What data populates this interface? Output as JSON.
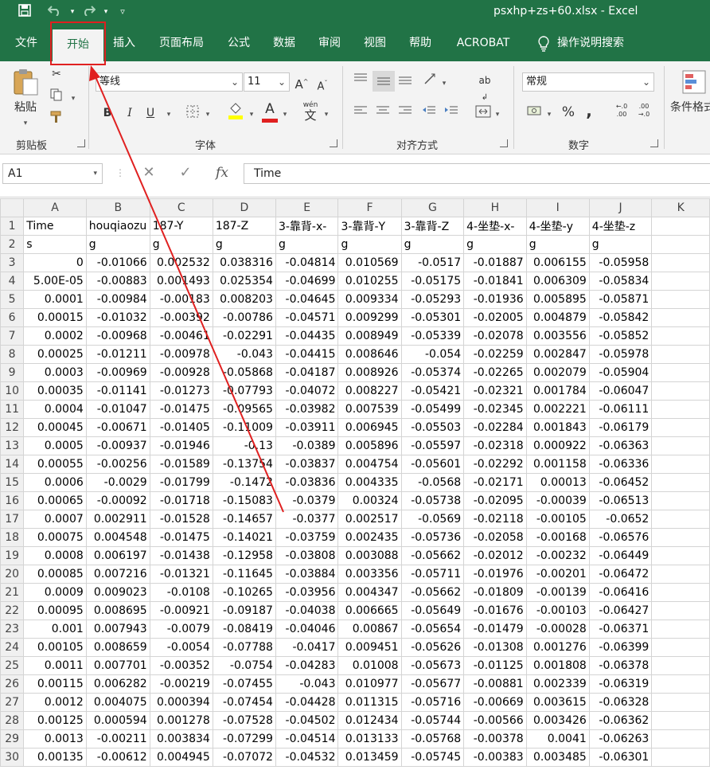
{
  "title_bar": {
    "title": "psxhp+zs+60.xlsx  -  Excel"
  },
  "tabs": [
    {
      "label": "文件",
      "active": false
    },
    {
      "label": "开始",
      "active": true
    },
    {
      "label": "插入",
      "active": false
    },
    {
      "label": "页面布局",
      "active": false
    },
    {
      "label": "公式",
      "active": false
    },
    {
      "label": "数据",
      "active": false
    },
    {
      "label": "审阅",
      "active": false
    },
    {
      "label": "视图",
      "active": false
    },
    {
      "label": "帮助",
      "active": false
    },
    {
      "label": "ACROBAT",
      "active": false
    }
  ],
  "tell_me": "操作说明搜索",
  "ribbon": {
    "clipboard": {
      "label": "剪贴板",
      "paste": "粘贴"
    },
    "font": {
      "label": "字体",
      "font_name": "等线",
      "font_size": "11",
      "bold": "B",
      "italic": "I",
      "underline": "U",
      "font_color": "A",
      "phonetic": "wén",
      "phonetic_sub": "文"
    },
    "alignment": {
      "label": "对齐方式"
    },
    "number": {
      "label": "数字",
      "format": "常规",
      "percent": "%",
      "comma": ","
    },
    "styles": {
      "conditional": "条件格式"
    }
  },
  "formula_bar": {
    "name_box": "A1",
    "formula": "Time"
  },
  "accent_colors": {
    "excel_green": "#217346",
    "highlight_red": "#e02020",
    "font_color_red": "#e02020",
    "fill_yellow": "#ffff00"
  },
  "sheet": {
    "columns": [
      "A",
      "B",
      "C",
      "D",
      "E",
      "F",
      "G",
      "H",
      "I",
      "J",
      "K"
    ],
    "header_row": [
      "Time",
      "houqiaozu",
      "187-Y",
      "187-Z",
      "3-靠背-x-",
      "3-靠背-Y",
      "3-靠背-Z",
      "4-坐垫-x-",
      "4-坐垫-y",
      "4-坐垫-z",
      ""
    ],
    "unit_row": [
      "s",
      "g",
      "g",
      "g",
      "g",
      "g",
      "g",
      "g",
      "g",
      "g",
      ""
    ],
    "data_rows": [
      [
        "0",
        "-0.01066",
        "0.002532",
        "0.038316",
        "-0.04814",
        "0.010569",
        "-0.0517",
        "-0.01887",
        "0.006155",
        "-0.05958"
      ],
      [
        "5.00E-05",
        "-0.00883",
        "0.001493",
        "0.025354",
        "-0.04699",
        "0.010255",
        "-0.05175",
        "-0.01841",
        "0.006309",
        "-0.05834"
      ],
      [
        "0.0001",
        "-0.00984",
        "-0.00183",
        "0.008203",
        "-0.04645",
        "0.009334",
        "-0.05293",
        "-0.01936",
        "0.005895",
        "-0.05871"
      ],
      [
        "0.00015",
        "-0.01032",
        "-0.00392",
        "-0.00786",
        "-0.04571",
        "0.009299",
        "-0.05301",
        "-0.02005",
        "0.004879",
        "-0.05842"
      ],
      [
        "0.0002",
        "-0.00968",
        "-0.00461",
        "-0.02291",
        "-0.04435",
        "0.008949",
        "-0.05339",
        "-0.02078",
        "0.003556",
        "-0.05852"
      ],
      [
        "0.00025",
        "-0.01211",
        "-0.00978",
        "-0.043",
        "-0.04415",
        "0.008646",
        "-0.054",
        "-0.02259",
        "0.002847",
        "-0.05978"
      ],
      [
        "0.0003",
        "-0.00969",
        "-0.00928",
        "-0.05868",
        "-0.04187",
        "0.008926",
        "-0.05374",
        "-0.02265",
        "0.002079",
        "-0.05904"
      ],
      [
        "0.00035",
        "-0.01141",
        "-0.01273",
        "-0.07793",
        "-0.04072",
        "0.008227",
        "-0.05421",
        "-0.02321",
        "0.001784",
        "-0.06047"
      ],
      [
        "0.0004",
        "-0.01047",
        "-0.01475",
        "-0.09565",
        "-0.03982",
        "0.007539",
        "-0.05499",
        "-0.02345",
        "0.002221",
        "-0.06111"
      ],
      [
        "0.00045",
        "-0.00671",
        "-0.01405",
        "-0.11009",
        "-0.03911",
        "0.006945",
        "-0.05503",
        "-0.02284",
        "0.001843",
        "-0.06179"
      ],
      [
        "0.0005",
        "-0.00937",
        "-0.01946",
        "-0.13",
        "-0.0389",
        "0.005896",
        "-0.05597",
        "-0.02318",
        "0.000922",
        "-0.06363"
      ],
      [
        "0.00055",
        "-0.00256",
        "-0.01589",
        "-0.13754",
        "-0.03837",
        "0.004754",
        "-0.05601",
        "-0.02292",
        "0.001158",
        "-0.06336"
      ],
      [
        "0.0006",
        "-0.0029",
        "-0.01799",
        "-0.1472",
        "-0.03836",
        "0.004335",
        "-0.0568",
        "-0.02171",
        "0.00013",
        "-0.06452"
      ],
      [
        "0.00065",
        "-0.00092",
        "-0.01718",
        "-0.15083",
        "-0.0379",
        "0.00324",
        "-0.05738",
        "-0.02095",
        "-0.00039",
        "-0.06513"
      ],
      [
        "0.0007",
        "0.002911",
        "-0.01528",
        "-0.14657",
        "-0.0377",
        "0.002517",
        "-0.0569",
        "-0.02118",
        "-0.00105",
        "-0.0652"
      ],
      [
        "0.00075",
        "0.004548",
        "-0.01475",
        "-0.14021",
        "-0.03759",
        "0.002435",
        "-0.05736",
        "-0.02058",
        "-0.00168",
        "-0.06576"
      ],
      [
        "0.0008",
        "0.006197",
        "-0.01438",
        "-0.12958",
        "-0.03808",
        "0.003088",
        "-0.05662",
        "-0.02012",
        "-0.00232",
        "-0.06449"
      ],
      [
        "0.00085",
        "0.007216",
        "-0.01321",
        "-0.11645",
        "-0.03884",
        "0.003356",
        "-0.05711",
        "-0.01976",
        "-0.00201",
        "-0.06472"
      ],
      [
        "0.0009",
        "0.009023",
        "-0.0108",
        "-0.10265",
        "-0.03956",
        "0.004347",
        "-0.05662",
        "-0.01809",
        "-0.00139",
        "-0.06416"
      ],
      [
        "0.00095",
        "0.008695",
        "-0.00921",
        "-0.09187",
        "-0.04038",
        "0.006665",
        "-0.05649",
        "-0.01676",
        "-0.00103",
        "-0.06427"
      ],
      [
        "0.001",
        "0.007943",
        "-0.0079",
        "-0.08419",
        "-0.04046",
        "0.00867",
        "-0.05654",
        "-0.01479",
        "-0.00028",
        "-0.06371"
      ],
      [
        "0.00105",
        "0.008659",
        "-0.0054",
        "-0.07788",
        "-0.0417",
        "0.009451",
        "-0.05626",
        "-0.01308",
        "0.001276",
        "-0.06399"
      ],
      [
        "0.0011",
        "0.007701",
        "-0.00352",
        "-0.0754",
        "-0.04283",
        "0.01008",
        "-0.05673",
        "-0.01125",
        "0.001808",
        "-0.06378"
      ],
      [
        "0.00115",
        "0.006282",
        "-0.00219",
        "-0.07455",
        "-0.043",
        "0.010977",
        "-0.05677",
        "-0.00881",
        "0.002339",
        "-0.06319"
      ],
      [
        "0.0012",
        "0.004075",
        "0.000394",
        "-0.07454",
        "-0.04428",
        "0.011315",
        "-0.05716",
        "-0.00669",
        "0.003615",
        "-0.06328"
      ],
      [
        "0.00125",
        "0.000594",
        "0.001278",
        "-0.07528",
        "-0.04502",
        "0.012434",
        "-0.05744",
        "-0.00566",
        "0.003426",
        "-0.06362"
      ],
      [
        "0.0013",
        "-0.00211",
        "0.003834",
        "-0.07299",
        "-0.04514",
        "0.013133",
        "-0.05768",
        "-0.00378",
        "0.0041",
        "-0.06263"
      ],
      [
        "0.00135",
        "-0.00612",
        "0.004945",
        "-0.07072",
        "-0.04532",
        "0.013459",
        "-0.05745",
        "-0.00383",
        "0.003485",
        "-0.06301"
      ]
    ],
    "row_start": 3
  }
}
